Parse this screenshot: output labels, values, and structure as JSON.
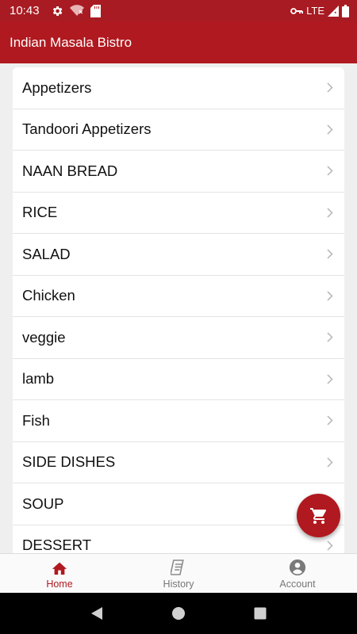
{
  "status_bar": {
    "time": "10:43",
    "network": "LTE",
    "icons": [
      "settings-gear-icon",
      "wifi-off-icon",
      "sd-card-icon",
      "vpn-key-icon",
      "signal-icon",
      "battery-icon"
    ]
  },
  "app_bar": {
    "title": "Indian Masala Bistro"
  },
  "menu": {
    "items": [
      {
        "label": "Appetizers"
      },
      {
        "label": "Tandoori Appetizers"
      },
      {
        "label": "NAAN BREAD"
      },
      {
        "label": "RICE"
      },
      {
        "label": "SALAD"
      },
      {
        "label": "Chicken"
      },
      {
        "label": "veggie"
      },
      {
        "label": "lamb"
      },
      {
        "label": "Fish"
      },
      {
        "label": "SIDE DISHES"
      },
      {
        "label": "SOUP"
      },
      {
        "label": "DESSERT"
      }
    ]
  },
  "fab": {
    "icon": "shopping-cart-icon"
  },
  "bottom_nav": {
    "items": [
      {
        "label": "Home",
        "icon": "home-icon",
        "active": true
      },
      {
        "label": "History",
        "icon": "receipt-icon",
        "active": false
      },
      {
        "label": "Account",
        "icon": "account-circle-icon",
        "active": false
      }
    ]
  },
  "colors": {
    "brand": "#b0191f",
    "status_bar": "#a81b22",
    "background": "#efefef",
    "inactive": "#777777"
  }
}
